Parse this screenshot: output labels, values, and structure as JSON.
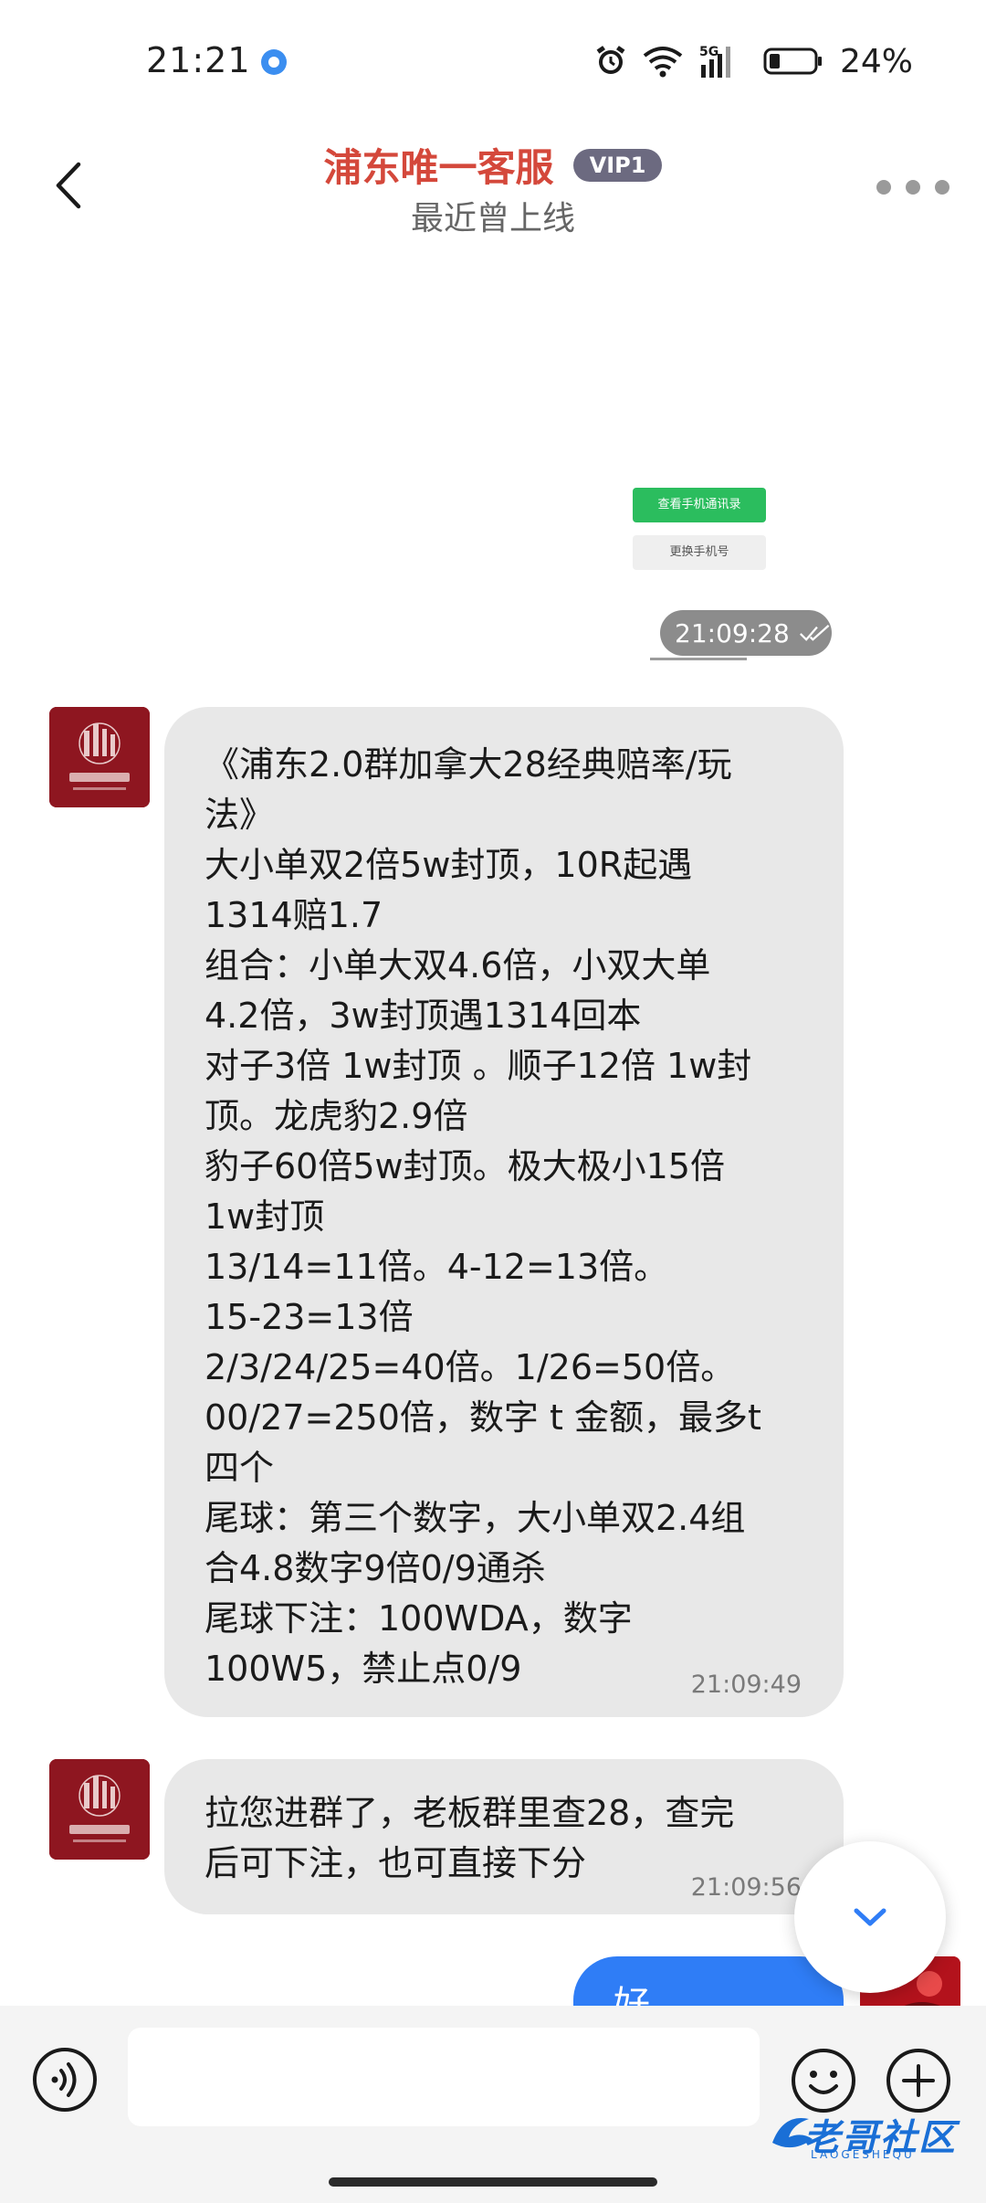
{
  "status_bar": {
    "time": "21:21",
    "battery_percent": "24%",
    "network": "5G"
  },
  "header": {
    "title": "浦东唯一客服",
    "vip_badge": "VIP1",
    "subtitle": "最近曾上线"
  },
  "thumbnail": {
    "primary_button": "查看手机通讯录",
    "secondary_button": "更换手机号"
  },
  "sent_time": "21:09:28",
  "messages": [
    {
      "lines": [
        "《浦东2.0群加拿大28经典赔率/玩",
        "法》",
        "大小单双2倍5w封顶，10R起遇",
        "1314赔1.7",
        "组合：小单大双4.6倍，小双大单",
        "4.2倍，3w封顶遇1314回本",
        "对子3倍 1w封顶 。顺子12倍 1w封",
        "顶。龙虎豹2.9倍",
        "豹子60倍5w封顶。极大极小15倍",
        "1w封顶",
        "13/14=11倍。4-12=13倍。",
        "15-23=13倍",
        "2/3/24/25=40倍。1/26=50倍。",
        "00/27=250倍，数字 t 金额，最多t",
        "四个",
        "尾球：第三个数字，大小单双2.4组",
        "合4.8数字9倍0/9通杀",
        "尾球下注：100WDA，数字",
        "100W5，禁止点0/9"
      ],
      "time": "21:09:49"
    },
    {
      "lines": [
        "拉您进群了，老板群里查28，查完",
        "后可下注，也可直接下分"
      ],
      "time": "21:09:56"
    }
  ],
  "outgoing_partial": "好",
  "input": {
    "placeholder": ""
  },
  "watermark": {
    "text": "老哥社区",
    "sub": "LAOGESHEQU"
  },
  "colors": {
    "title": "#d4483b",
    "bubble_in": "#e8e8e8",
    "bubble_out": "#2f7df6",
    "green_button": "#2bbd5e"
  }
}
